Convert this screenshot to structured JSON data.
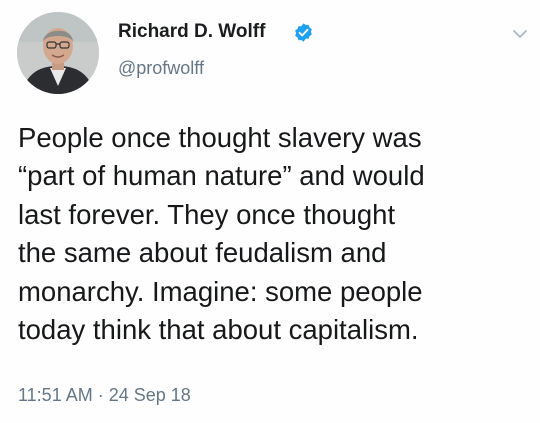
{
  "tweet": {
    "display_name": "Richard D. Wolff",
    "handle": "@profwolff",
    "text": "People once thought slavery was\n“part of human nature” and would\nlast forever. They once thought\nthe same about feudalism and\nmonarchy. Imagine: some people\ntoday think that about capitalism.",
    "timestamp": "11:51 AM · 24 Sep 18"
  },
  "icons": {
    "verified": "verified-badge-icon",
    "caret": "chevron-down-icon"
  },
  "colors": {
    "verified_blue": "#1da1f2",
    "secondary_text": "#657786",
    "primary_text": "#14171a"
  }
}
